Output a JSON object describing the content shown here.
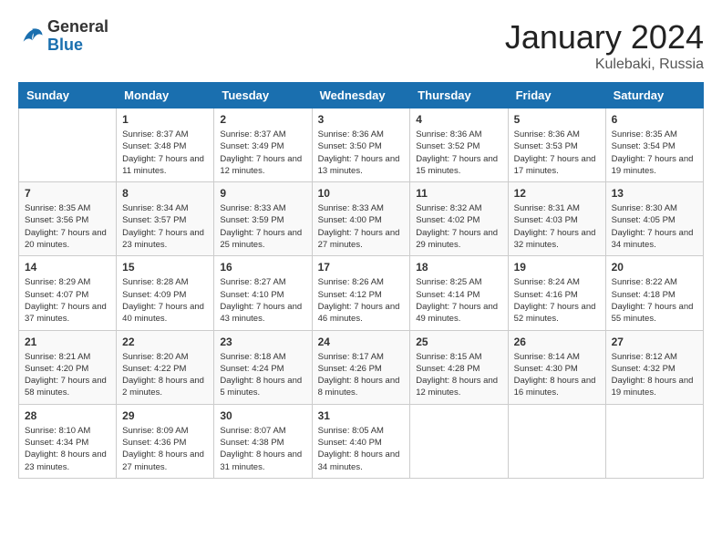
{
  "header": {
    "logo_general": "General",
    "logo_blue": "Blue",
    "month": "January 2024",
    "location": "Kulebaki, Russia"
  },
  "weekdays": [
    "Sunday",
    "Monday",
    "Tuesday",
    "Wednesday",
    "Thursday",
    "Friday",
    "Saturday"
  ],
  "weeks": [
    [
      {
        "day": "",
        "sunrise": "",
        "sunset": "",
        "daylight": ""
      },
      {
        "day": "1",
        "sunrise": "Sunrise: 8:37 AM",
        "sunset": "Sunset: 3:48 PM",
        "daylight": "Daylight: 7 hours and 11 minutes."
      },
      {
        "day": "2",
        "sunrise": "Sunrise: 8:37 AM",
        "sunset": "Sunset: 3:49 PM",
        "daylight": "Daylight: 7 hours and 12 minutes."
      },
      {
        "day": "3",
        "sunrise": "Sunrise: 8:36 AM",
        "sunset": "Sunset: 3:50 PM",
        "daylight": "Daylight: 7 hours and 13 minutes."
      },
      {
        "day": "4",
        "sunrise": "Sunrise: 8:36 AM",
        "sunset": "Sunset: 3:52 PM",
        "daylight": "Daylight: 7 hours and 15 minutes."
      },
      {
        "day": "5",
        "sunrise": "Sunrise: 8:36 AM",
        "sunset": "Sunset: 3:53 PM",
        "daylight": "Daylight: 7 hours and 17 minutes."
      },
      {
        "day": "6",
        "sunrise": "Sunrise: 8:35 AM",
        "sunset": "Sunset: 3:54 PM",
        "daylight": "Daylight: 7 hours and 19 minutes."
      }
    ],
    [
      {
        "day": "7",
        "sunrise": "Sunrise: 8:35 AM",
        "sunset": "Sunset: 3:56 PM",
        "daylight": "Daylight: 7 hours and 20 minutes."
      },
      {
        "day": "8",
        "sunrise": "Sunrise: 8:34 AM",
        "sunset": "Sunset: 3:57 PM",
        "daylight": "Daylight: 7 hours and 23 minutes."
      },
      {
        "day": "9",
        "sunrise": "Sunrise: 8:33 AM",
        "sunset": "Sunset: 3:59 PM",
        "daylight": "Daylight: 7 hours and 25 minutes."
      },
      {
        "day": "10",
        "sunrise": "Sunrise: 8:33 AM",
        "sunset": "Sunset: 4:00 PM",
        "daylight": "Daylight: 7 hours and 27 minutes."
      },
      {
        "day": "11",
        "sunrise": "Sunrise: 8:32 AM",
        "sunset": "Sunset: 4:02 PM",
        "daylight": "Daylight: 7 hours and 29 minutes."
      },
      {
        "day": "12",
        "sunrise": "Sunrise: 8:31 AM",
        "sunset": "Sunset: 4:03 PM",
        "daylight": "Daylight: 7 hours and 32 minutes."
      },
      {
        "day": "13",
        "sunrise": "Sunrise: 8:30 AM",
        "sunset": "Sunset: 4:05 PM",
        "daylight": "Daylight: 7 hours and 34 minutes."
      }
    ],
    [
      {
        "day": "14",
        "sunrise": "Sunrise: 8:29 AM",
        "sunset": "Sunset: 4:07 PM",
        "daylight": "Daylight: 7 hours and 37 minutes."
      },
      {
        "day": "15",
        "sunrise": "Sunrise: 8:28 AM",
        "sunset": "Sunset: 4:09 PM",
        "daylight": "Daylight: 7 hours and 40 minutes."
      },
      {
        "day": "16",
        "sunrise": "Sunrise: 8:27 AM",
        "sunset": "Sunset: 4:10 PM",
        "daylight": "Daylight: 7 hours and 43 minutes."
      },
      {
        "day": "17",
        "sunrise": "Sunrise: 8:26 AM",
        "sunset": "Sunset: 4:12 PM",
        "daylight": "Daylight: 7 hours and 46 minutes."
      },
      {
        "day": "18",
        "sunrise": "Sunrise: 8:25 AM",
        "sunset": "Sunset: 4:14 PM",
        "daylight": "Daylight: 7 hours and 49 minutes."
      },
      {
        "day": "19",
        "sunrise": "Sunrise: 8:24 AM",
        "sunset": "Sunset: 4:16 PM",
        "daylight": "Daylight: 7 hours and 52 minutes."
      },
      {
        "day": "20",
        "sunrise": "Sunrise: 8:22 AM",
        "sunset": "Sunset: 4:18 PM",
        "daylight": "Daylight: 7 hours and 55 minutes."
      }
    ],
    [
      {
        "day": "21",
        "sunrise": "Sunrise: 8:21 AM",
        "sunset": "Sunset: 4:20 PM",
        "daylight": "Daylight: 7 hours and 58 minutes."
      },
      {
        "day": "22",
        "sunrise": "Sunrise: 8:20 AM",
        "sunset": "Sunset: 4:22 PM",
        "daylight": "Daylight: 8 hours and 2 minutes."
      },
      {
        "day": "23",
        "sunrise": "Sunrise: 8:18 AM",
        "sunset": "Sunset: 4:24 PM",
        "daylight": "Daylight: 8 hours and 5 minutes."
      },
      {
        "day": "24",
        "sunrise": "Sunrise: 8:17 AM",
        "sunset": "Sunset: 4:26 PM",
        "daylight": "Daylight: 8 hours and 8 minutes."
      },
      {
        "day": "25",
        "sunrise": "Sunrise: 8:15 AM",
        "sunset": "Sunset: 4:28 PM",
        "daylight": "Daylight: 8 hours and 12 minutes."
      },
      {
        "day": "26",
        "sunrise": "Sunrise: 8:14 AM",
        "sunset": "Sunset: 4:30 PM",
        "daylight": "Daylight: 8 hours and 16 minutes."
      },
      {
        "day": "27",
        "sunrise": "Sunrise: 8:12 AM",
        "sunset": "Sunset: 4:32 PM",
        "daylight": "Daylight: 8 hours and 19 minutes."
      }
    ],
    [
      {
        "day": "28",
        "sunrise": "Sunrise: 8:10 AM",
        "sunset": "Sunset: 4:34 PM",
        "daylight": "Daylight: 8 hours and 23 minutes."
      },
      {
        "day": "29",
        "sunrise": "Sunrise: 8:09 AM",
        "sunset": "Sunset: 4:36 PM",
        "daylight": "Daylight: 8 hours and 27 minutes."
      },
      {
        "day": "30",
        "sunrise": "Sunrise: 8:07 AM",
        "sunset": "Sunset: 4:38 PM",
        "daylight": "Daylight: 8 hours and 31 minutes."
      },
      {
        "day": "31",
        "sunrise": "Sunrise: 8:05 AM",
        "sunset": "Sunset: 4:40 PM",
        "daylight": "Daylight: 8 hours and 34 minutes."
      },
      {
        "day": "",
        "sunrise": "",
        "sunset": "",
        "daylight": ""
      },
      {
        "day": "",
        "sunrise": "",
        "sunset": "",
        "daylight": ""
      },
      {
        "day": "",
        "sunrise": "",
        "sunset": "",
        "daylight": ""
      }
    ]
  ]
}
